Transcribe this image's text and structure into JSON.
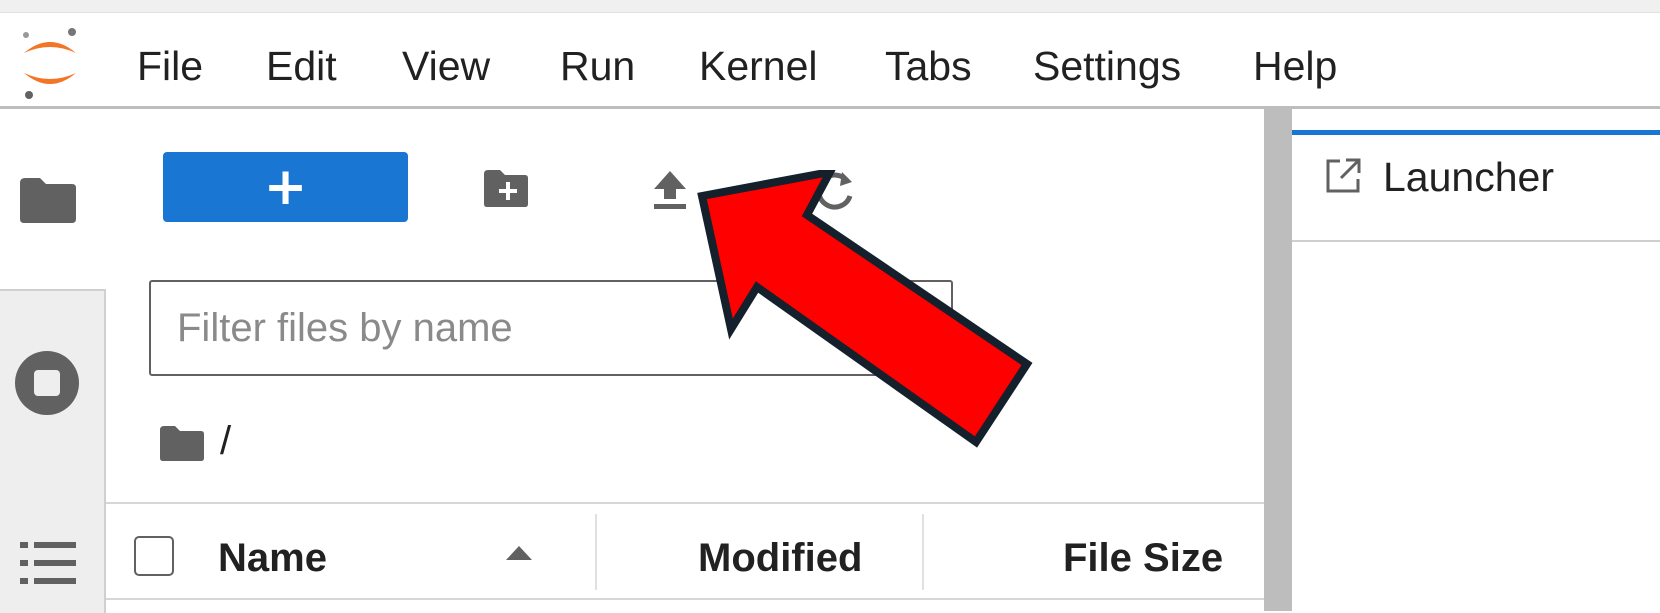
{
  "app": {
    "logo_icon": "jupyter-logo-icon",
    "accent_color": "#1976d2",
    "logo_color": "#f37626"
  },
  "menu": {
    "items": [
      "File",
      "Edit",
      "View",
      "Run",
      "Kernel",
      "Tabs",
      "Settings",
      "Help"
    ]
  },
  "activity_bar": {
    "icons": [
      "folder-icon",
      "stop-circle-icon",
      "list-icon"
    ]
  },
  "file_browser": {
    "toolbar": {
      "new_label": "+",
      "icons": [
        "new-folder-icon",
        "upload-icon",
        "refresh-icon"
      ]
    },
    "filter": {
      "placeholder": "Filter files by name",
      "value": ""
    },
    "breadcrumb": {
      "icon": "folder-icon",
      "path": "/"
    },
    "columns": {
      "name": "Name",
      "modified": "Modified",
      "size": "File Size",
      "sort_icon": "caret-up-icon"
    }
  },
  "main": {
    "tabs": [
      {
        "label": "Launcher",
        "icon": "launch-icon"
      }
    ]
  },
  "annotation": {
    "arrow_color": "#ff0000",
    "arrow_outline": "#14202c"
  }
}
